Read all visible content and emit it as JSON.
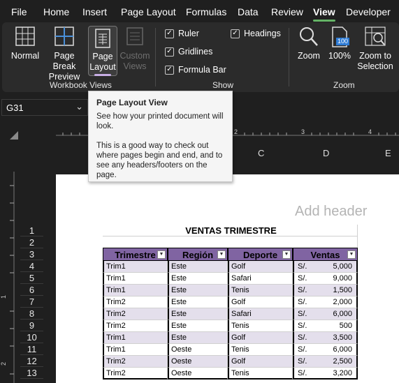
{
  "menu": [
    "File",
    "Home",
    "Insert",
    "Page Layout",
    "Formulas",
    "Data",
    "Review",
    "View",
    "Developer"
  ],
  "active_menu": "View",
  "ribbon": {
    "workbook_views": {
      "label": "Workbook Views",
      "normal": "Normal",
      "page_break_1": "Page Break",
      "page_break_2": "Preview",
      "page_layout_1": "Page",
      "page_layout_2": "Layout",
      "custom_1": "Custom",
      "custom_2": "Views"
    },
    "show": {
      "label": "Show",
      "ruler": "Ruler",
      "gridlines": "Gridlines",
      "formula_bar": "Formula Bar",
      "headings": "Headings"
    },
    "zoom": {
      "label": "Zoom",
      "zoom": "Zoom",
      "hundred": "100%",
      "hundred_icon": "100",
      "zoom_sel_1": "Zoom to",
      "zoom_sel_2": "Selection"
    }
  },
  "namebox": "G31",
  "tooltip": {
    "title": "Page Layout View",
    "p1": "See how your printed document will look.",
    "p2": "This is a good way to check out where pages begin and end, and to see any headers/footers on the page."
  },
  "ruler_marks": [
    "2",
    "3",
    "4"
  ],
  "vruler_marks": [
    "1",
    "2"
  ],
  "columns": [
    "C",
    "D",
    "E"
  ],
  "add_header": "Add header",
  "rows": [
    "1",
    "2",
    "3",
    "4",
    "5",
    "6",
    "7",
    "8",
    "9",
    "10",
    "11",
    "12",
    "13"
  ],
  "table": {
    "title": "VENTAS TRIMESTRE",
    "headers": [
      "Trimestre",
      "Región",
      "Deporte",
      "Ventas"
    ],
    "currency": "S/.",
    "data": [
      [
        "Trim1",
        "Este",
        "Golf",
        "5,000"
      ],
      [
        "Trim1",
        "Este",
        "Safari",
        "9,000"
      ],
      [
        "Trim1",
        "Este",
        "Tenis",
        "1,500"
      ],
      [
        "Trim2",
        "Este",
        "Golf",
        "2,000"
      ],
      [
        "Trim2",
        "Este",
        "Safari",
        "6,000"
      ],
      [
        "Trim2",
        "Este",
        "Tenis",
        "500"
      ],
      [
        "Trim1",
        "Este",
        "Golf",
        "3,500"
      ],
      [
        "Trim1",
        "Oeste",
        "Tenis",
        "6,000"
      ],
      [
        "Trim2",
        "Oeste",
        "Golf",
        "2,500"
      ],
      [
        "Trim2",
        "Oeste",
        "Tenis",
        "3,200"
      ]
    ]
  },
  "colors": {
    "header_fill": "#8064a2",
    "band_fill": "#e4dfec",
    "active_tab_underline": "#64b466"
  }
}
